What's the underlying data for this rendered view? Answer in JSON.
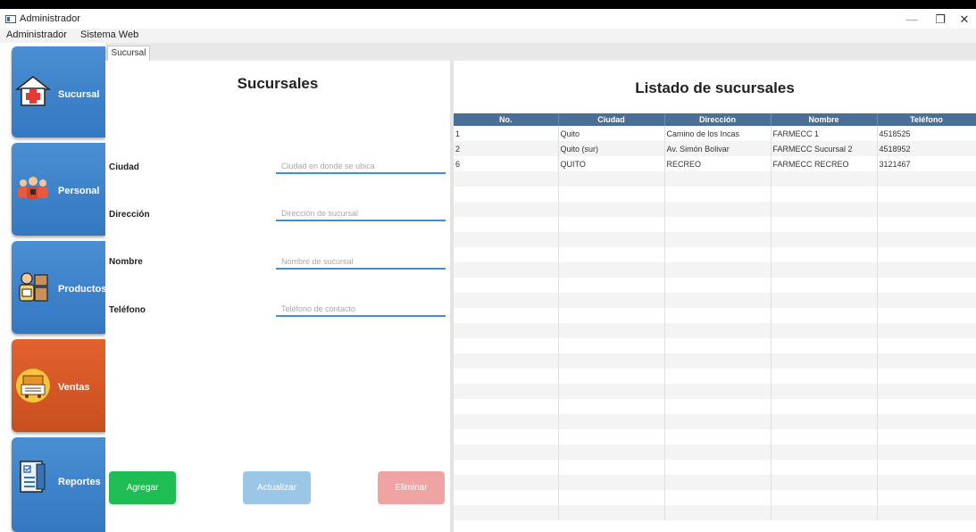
{
  "window": {
    "title": "Administrador",
    "min_glyph": "—",
    "max_glyph": "❐",
    "close_glyph": "✕"
  },
  "menu": [
    "Administrador",
    "Sistema Web"
  ],
  "tabs": [
    {
      "label": "Sucursal"
    }
  ],
  "sidebar": {
    "items": [
      {
        "label": "Sucursal",
        "icon": "hospital-icon",
        "color": "#3f85cc"
      },
      {
        "label": "Personal",
        "icon": "staff-icon",
        "color": "#3f85cc"
      },
      {
        "label": "Productos",
        "icon": "products-icon",
        "color": "#3f85cc"
      },
      {
        "label": "Ventas",
        "icon": "cash-register-icon",
        "color": "#d65a28"
      },
      {
        "label": "Reportes",
        "icon": "report-icon",
        "color": "#3f85cc"
      }
    ]
  },
  "form": {
    "title": "Sucursales",
    "fields": [
      {
        "label": "Ciudad",
        "placeholder": "Ciudad en donde se ubica",
        "value": ""
      },
      {
        "label": "Dirección",
        "placeholder": "Dirección de sucursal",
        "value": ""
      },
      {
        "label": "Nombre",
        "placeholder": "Nombre de sucursal",
        "value": ""
      },
      {
        "label": "Teléfono",
        "placeholder": "Teléfono de contacto",
        "value": ""
      }
    ],
    "buttons": {
      "add": {
        "label": "Agregar",
        "color": "#1fbe55"
      },
      "update": {
        "label": "Actualizar",
        "color": "#9cc6e6"
      },
      "delete": {
        "label": "Eliminar",
        "color": "#f0a3a3"
      }
    }
  },
  "list": {
    "title": "Listado de sucursales",
    "columns": [
      "No.",
      "Ciudad",
      "Dirección",
      "Nombre",
      "Teléfono"
    ],
    "rows": [
      [
        "1",
        "Quito",
        "Camino de los Incas",
        "FARMECC 1",
        "4518525"
      ],
      [
        "2",
        "Quito (sur)",
        "Av. Simón Bolivar",
        "FARMECC Sucursal 2",
        "4518952"
      ],
      [
        "6",
        "QUITO",
        "RECREO",
        "FARMECC  RECREO",
        "3121467"
      ]
    ]
  }
}
